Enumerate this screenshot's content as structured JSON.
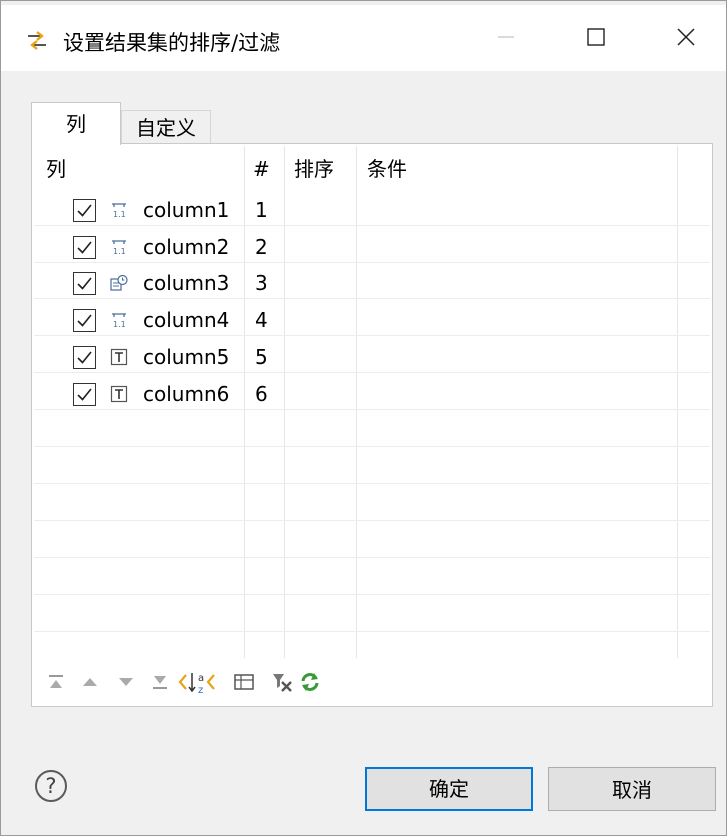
{
  "window": {
    "title": "设置结果集的排序/过滤"
  },
  "tabs": [
    {
      "label": "列",
      "active": true
    },
    {
      "label": "自定义",
      "active": false
    }
  ],
  "table": {
    "headers": [
      "列",
      "#",
      "排序",
      "条件"
    ],
    "rows": [
      {
        "checked": true,
        "icon": "numeric-column-icon",
        "name": "column1",
        "number": "1",
        "sort": "",
        "condition": ""
      },
      {
        "checked": true,
        "icon": "numeric-column-icon",
        "name": "column2",
        "number": "2",
        "sort": "",
        "condition": ""
      },
      {
        "checked": true,
        "icon": "datetime-column-icon",
        "name": "column3",
        "number": "3",
        "sort": "",
        "condition": ""
      },
      {
        "checked": true,
        "icon": "numeric-column-icon",
        "name": "column4",
        "number": "4",
        "sort": "",
        "condition": ""
      },
      {
        "checked": true,
        "icon": "text-column-icon",
        "name": "column5",
        "number": "5",
        "sort": "",
        "condition": ""
      },
      {
        "checked": true,
        "icon": "text-column-icon",
        "name": "column6",
        "number": "6",
        "sort": "",
        "condition": ""
      }
    ]
  },
  "toolbar": {
    "icons": [
      "move-top-icon",
      "move-up-icon",
      "move-down-icon",
      "move-bottom-icon",
      "sort-az-icon",
      "table-view-icon",
      "clear-filter-icon",
      "refresh-icon"
    ]
  },
  "buttons": {
    "ok": "确定",
    "cancel": "取消"
  },
  "colors": {
    "accent": "#0078d7",
    "window_bg": "#f0f0f0"
  }
}
